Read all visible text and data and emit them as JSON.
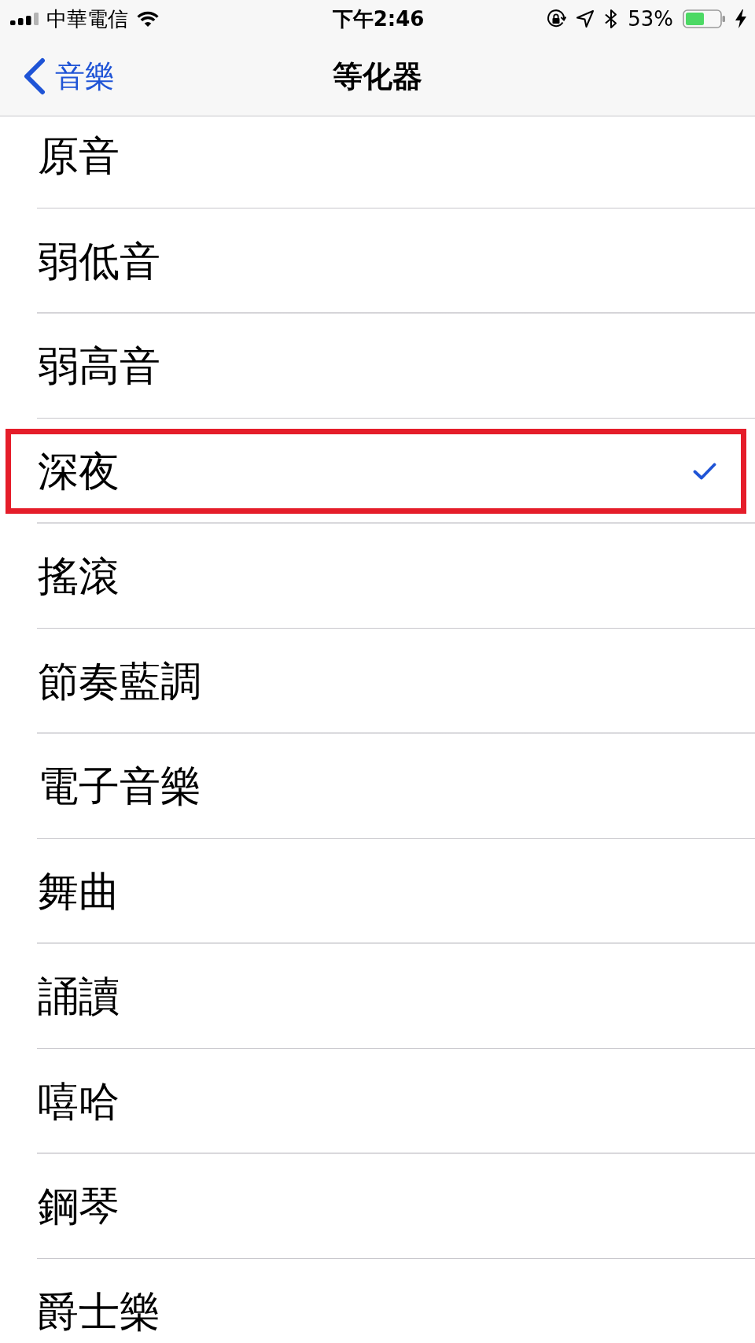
{
  "status_bar": {
    "carrier": "中華電信",
    "time": "下午2:46",
    "battery_percent": "53%",
    "charging": true
  },
  "nav_bar": {
    "back_label": "音樂",
    "title": "等化器"
  },
  "items": [
    {
      "label": "原音",
      "selected": false,
      "highlighted": false
    },
    {
      "label": "弱低音",
      "selected": false,
      "highlighted": false
    },
    {
      "label": "弱高音",
      "selected": false,
      "highlighted": false
    },
    {
      "label": "深夜",
      "selected": true,
      "highlighted": true
    },
    {
      "label": "搖滾",
      "selected": false,
      "highlighted": false
    },
    {
      "label": "節奏藍調",
      "selected": false,
      "highlighted": false
    },
    {
      "label": "電子音樂",
      "selected": false,
      "highlighted": false
    },
    {
      "label": "舞曲",
      "selected": false,
      "highlighted": false
    },
    {
      "label": "誦讀",
      "selected": false,
      "highlighted": false
    },
    {
      "label": "嘻哈",
      "selected": false,
      "highlighted": false
    },
    {
      "label": "鋼琴",
      "selected": false,
      "highlighted": false
    },
    {
      "label": "爵士樂",
      "selected": false,
      "highlighted": false
    }
  ]
}
